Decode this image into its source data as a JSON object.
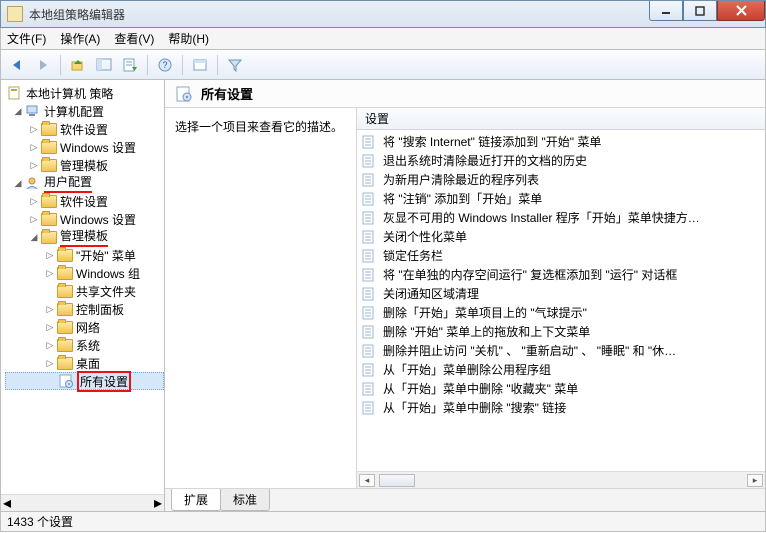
{
  "window": {
    "title": "本地组策略编辑器"
  },
  "menu": {
    "file": "文件(F)",
    "action": "操作(A)",
    "view": "查看(V)",
    "help": "帮助(H)"
  },
  "tree": {
    "root": "本地计算机 策略",
    "computer": "计算机配置",
    "computer_children": {
      "software": "软件设置",
      "windows": "Windows 设置",
      "admin": "管理模板"
    },
    "user": "用户配置",
    "user_children": {
      "software": "软件设置",
      "windows": "Windows 设置",
      "admin": "管理模板",
      "admin_children": {
        "start": "\"开始\" 菜单",
        "wincomp": "Windows 组",
        "shared": "共享文件夹",
        "control": "控制面板",
        "network": "网络",
        "system": "系统",
        "desktop": "桌面",
        "all": "所有设置"
      }
    }
  },
  "right": {
    "header": "所有设置",
    "desc": "选择一个项目来查看它的描述。",
    "column": "设置",
    "items": [
      "将 \"搜索 Internet\" 链接添加到 \"开始\" 菜单",
      "退出系统时清除最近打开的文档的历史",
      "为新用户清除最近的程序列表",
      "将 \"注销\" 添加到「开始」菜单",
      "灰显不可用的 Windows Installer 程序「开始」菜单快捷方…",
      "关闭个性化菜单",
      "锁定任务栏",
      "将 \"在单独的内存空间运行\" 复选框添加到 \"运行\" 对话框",
      "关闭通知区域清理",
      "删除「开始」菜单项目上的 \"气球提示\"",
      "删除 \"开始\" 菜单上的拖放和上下文菜单",
      "删除并阻止访问 \"关机\" 、 \"重新启动\" 、 \"睡眠\" 和 \"休…",
      "从「开始」菜单删除公用程序组",
      "从「开始」菜单中删除 \"收藏夹\" 菜单",
      "从「开始」菜单中删除 \"搜索\" 链接"
    ]
  },
  "tabs": {
    "extended": "扩展",
    "standard": "标准"
  },
  "status": "1433 个设置"
}
